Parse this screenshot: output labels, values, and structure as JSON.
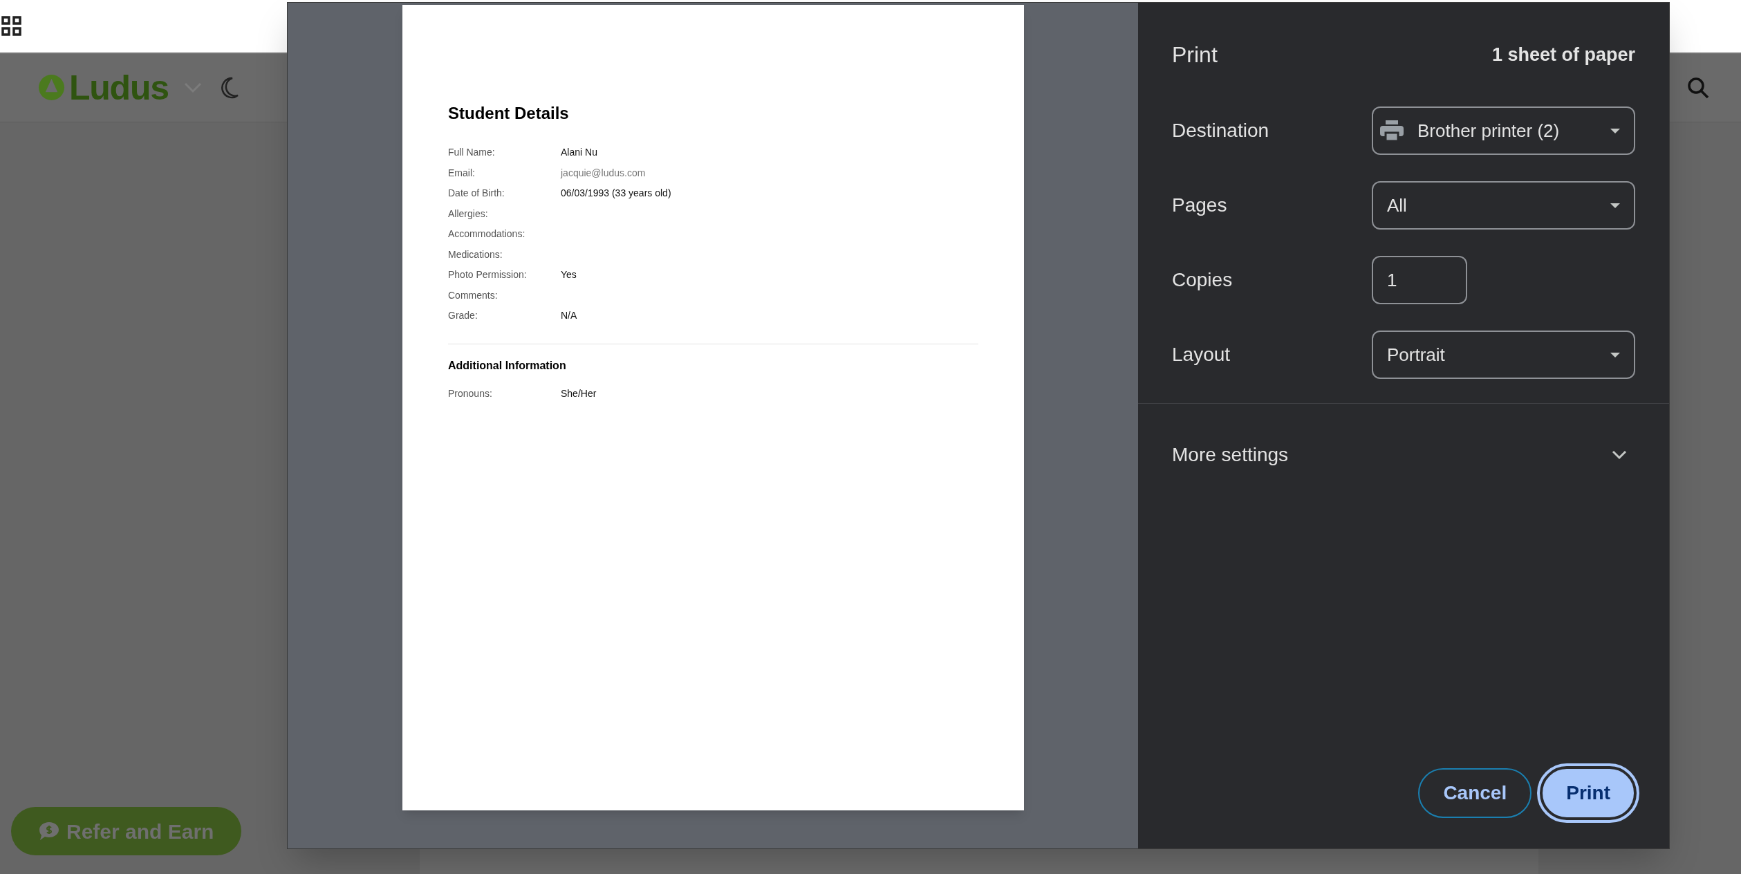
{
  "background_page": {
    "logo_text": "Ludus",
    "refer_button": {
      "label": "Refer and Earn"
    }
  },
  "print_preview": {
    "document": {
      "title": "Student Details",
      "fields": [
        {
          "label": "Full Name:",
          "value": "Alani Nu"
        },
        {
          "label": "Email:",
          "value": "jacquie@ludus.com",
          "muted": true
        },
        {
          "label": "Date of Birth:",
          "value": "06/03/1993 (33 years old)"
        },
        {
          "label": "Allergies:"
        },
        {
          "label": "Accommodations:"
        },
        {
          "label": "Medications:"
        },
        {
          "label": "Photo Permission:",
          "value": "Yes"
        },
        {
          "label": "Comments:"
        },
        {
          "label": "Grade:",
          "value": "N/A"
        }
      ],
      "section_title": "Additional Information",
      "additional_fields": [
        {
          "label": "Pronouns:",
          "value": "She/Her"
        }
      ]
    }
  },
  "print_dialog": {
    "title": "Print",
    "sheet_count": "1 sheet of paper",
    "settings": [
      {
        "kind": "destination",
        "label": "Destination",
        "value": "Brother printer (2)"
      },
      {
        "kind": "select",
        "label": "Pages",
        "value": "All"
      },
      {
        "kind": "number",
        "label": "Copies",
        "value": "1"
      },
      {
        "kind": "select",
        "label": "Layout",
        "value": "Portrait"
      }
    ],
    "more_settings": {
      "label": "More settings",
      "expanded": false
    },
    "buttons": [
      {
        "kind": "secondary",
        "label": "Cancel"
      },
      {
        "kind": "primary",
        "label": "Print"
      }
    ]
  }
}
